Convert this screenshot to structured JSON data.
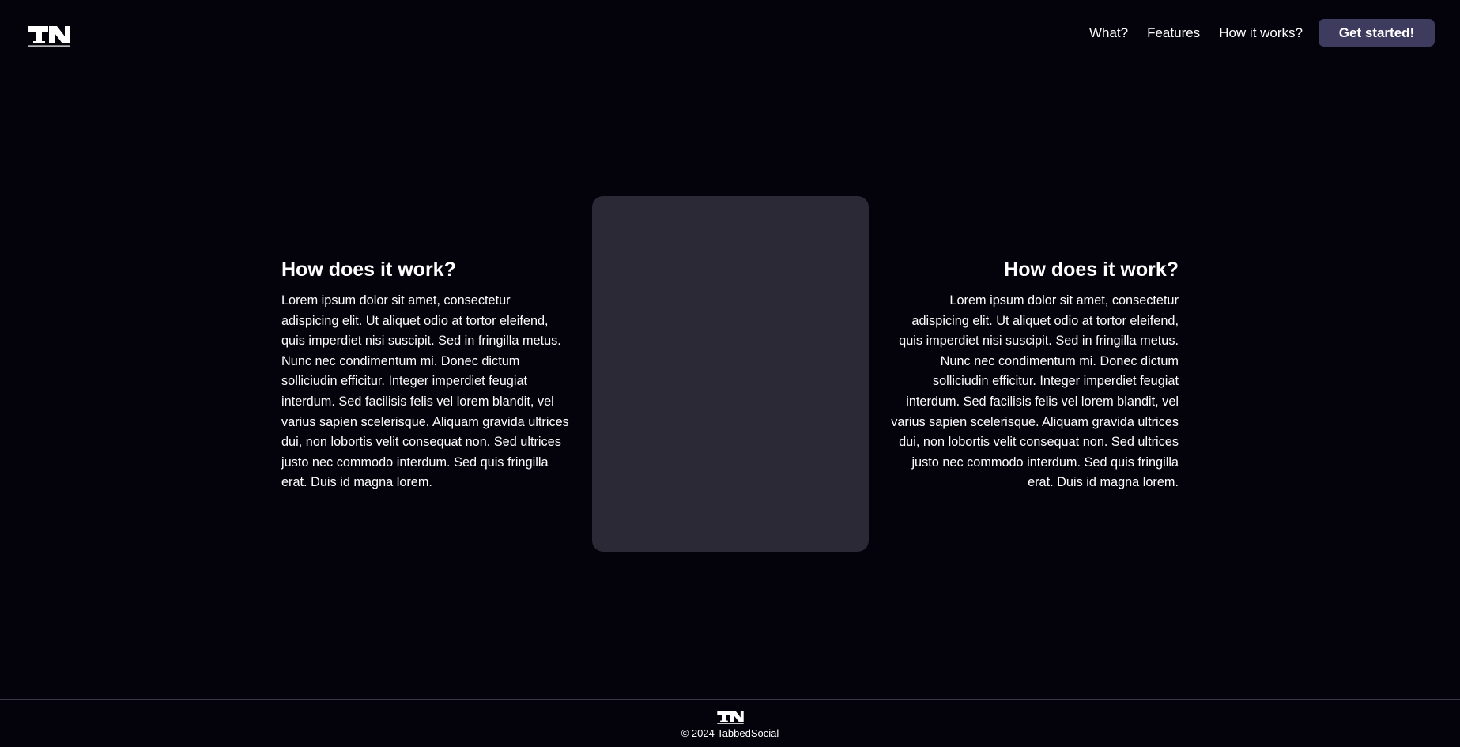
{
  "header": {
    "logo_icon": "ts-logo-icon",
    "nav": [
      {
        "label": "What?"
      },
      {
        "label": "Features"
      },
      {
        "label": "How it works?"
      }
    ],
    "cta_label": "Get started!",
    "cta_color": "#3d3b5e"
  },
  "main": {
    "left": {
      "title": "How does it work?",
      "body": "Lorem ipsum dolor sit amet, consectetur adispicing elit. Ut aliquet odio at tortor eleifend, quis imperdiet nisi suscipit. Sed in fringilla metus. Nunc nec condimentum mi. Donec dictum solliciudin efficitur. Integer imperdiet feugiat interdum. Sed facilisis felis vel lorem blandit, vel varius sapien scelerisque. Aliquam gravida ultrices dui, non lobortis velit consequat non. Sed ultrices justo nec commodo interdum. Sed quis fringilla erat. Duis id magna lorem."
    },
    "right": {
      "title": "How does it work?",
      "body": "Lorem ipsum dolor sit amet, consectetur adispicing elit. Ut aliquet odio at tortor eleifend, quis imperdiet nisi suscipit. Sed in fringilla metus. Nunc nec condimentum mi. Donec dictum solliciudin efficitur. Integer imperdiet feugiat interdum. Sed facilisis felis vel lorem blandit, vel varius sapien scelerisque. Aliquam gravida ultrices dui, non lobortis velit consequat non. Sed ultrices justo nec commodo interdum. Sed quis fringilla erat. Duis id magna lorem."
    },
    "card_color": "#2a2935"
  },
  "footer": {
    "logo_icon": "ts-logo-icon",
    "copyright": "© 2024 TabbedSocial"
  },
  "colors": {
    "background": "#04030c",
    "text": "#ffffff",
    "divider": "#3a3944"
  }
}
